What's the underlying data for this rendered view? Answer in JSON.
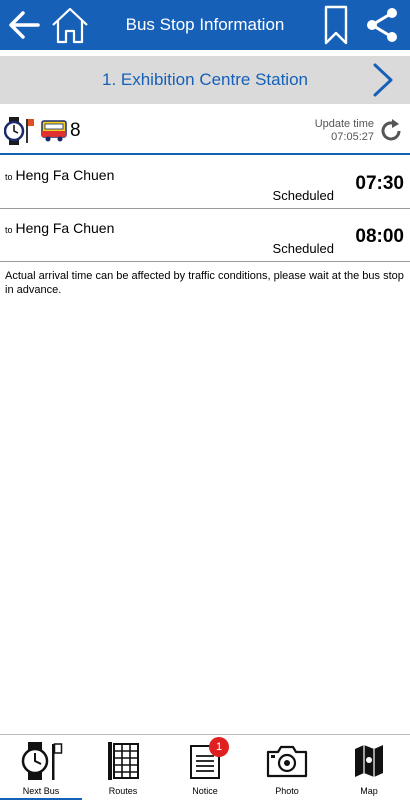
{
  "header": {
    "title": "Bus Stop Information",
    "back_icon": "arrow-left-icon",
    "home_icon": "home-icon",
    "bookmark_icon": "bookmark-icon",
    "share_icon": "share-icon",
    "bg_color": "#1660b8"
  },
  "stop": {
    "name": "1. Exhibition Centre Station",
    "next_icon": "chevron-right-icon"
  },
  "info": {
    "route_number": "8",
    "update_label": "Update time",
    "update_time": "07:05:27"
  },
  "arrivals": [
    {
      "to_prefix": "to",
      "destination": "Heng Fa Chuen",
      "status": "Scheduled",
      "time": "07:30"
    },
    {
      "to_prefix": "to",
      "destination": "Heng Fa Chuen",
      "status": "Scheduled",
      "time": "08:00"
    }
  ],
  "note": "Actual arrival time can be affected by traffic conditions, please wait at the bus stop in advance.",
  "tabs": [
    {
      "label": "Next Bus",
      "icon": "next-bus-icon",
      "active": true
    },
    {
      "label": "Routes",
      "icon": "timetable-icon"
    },
    {
      "label": "Notice",
      "icon": "notice-icon",
      "badge": "1"
    },
    {
      "label": "Photo",
      "icon": "camera-icon"
    },
    {
      "label": "Map",
      "icon": "map-icon"
    }
  ]
}
